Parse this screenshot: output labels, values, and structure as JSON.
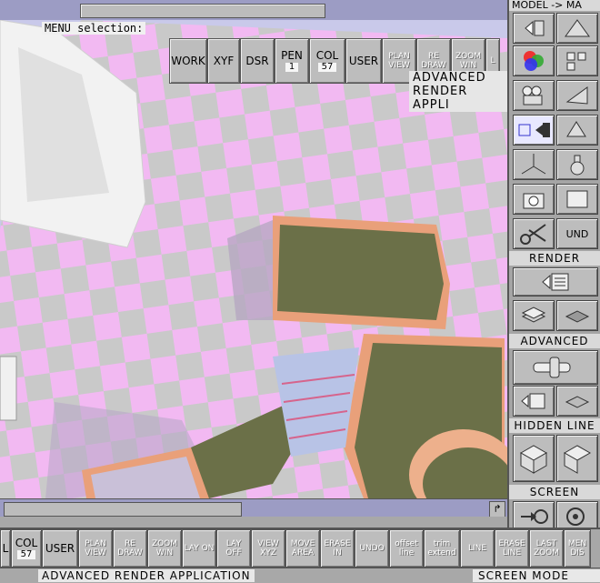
{
  "viewport": {
    "menu_selection": "MENU selection:",
    "title": "ADVANCED RENDER APPLI",
    "toolbar": [
      {
        "name": "work-button",
        "label": "WORK",
        "value": ""
      },
      {
        "name": "xyf-button",
        "label": "XYF",
        "value": ""
      },
      {
        "name": "dsr-button",
        "label": "DSR",
        "value": ""
      },
      {
        "name": "pen-button",
        "label": "PEN",
        "value": "1"
      },
      {
        "name": "col-button",
        "label": "COL",
        "value": "57"
      },
      {
        "name": "user-button",
        "label": "USER",
        "value": ""
      },
      {
        "name": "plan-view-button",
        "label": "PLAN VIEW",
        "value": ""
      },
      {
        "name": "redraw-button",
        "label": "RE DRAW",
        "value": ""
      },
      {
        "name": "zoom-win-button",
        "label": "ZOOM WIN",
        "value": ""
      },
      {
        "name": "more-button",
        "label": "L",
        "value": ""
      }
    ]
  },
  "right_panel": {
    "header": "MODEL -> MA",
    "sections": {
      "render": "RENDER",
      "advanced": "ADVANCED",
      "hidden_line": "HIDDEN LINE",
      "screen": "SCREEN"
    },
    "undo_label": "UND"
  },
  "bottom_toolbar": [
    {
      "label": "L",
      "value": ""
    },
    {
      "label": "COL",
      "value": "57"
    },
    {
      "label": "USER",
      "value": ""
    },
    {
      "label": "PLAN VIEW",
      "value": ""
    },
    {
      "label": "RE DRAW",
      "value": ""
    },
    {
      "label": "ZOOM WIN",
      "value": ""
    },
    {
      "label": "LAY ON",
      "value": ""
    },
    {
      "label": "LAY OFF",
      "value": ""
    },
    {
      "label": "VIEW XYZ",
      "value": ""
    },
    {
      "label": "MOVE AREA",
      "value": ""
    },
    {
      "label": "ERASE IN",
      "value": ""
    },
    {
      "label": "UNDO",
      "value": ""
    },
    {
      "label": "offset line",
      "value": ""
    },
    {
      "label": "trim extend",
      "value": ""
    },
    {
      "label": "LINE",
      "value": ""
    },
    {
      "label": "ERASE LINE",
      "value": ""
    },
    {
      "label": "LAST ZOOM",
      "value": ""
    },
    {
      "label": "MEN DIS",
      "value": ""
    }
  ],
  "status": {
    "left": "ADVANCED RENDER APPLICATION",
    "right": "SCREEN MODE"
  },
  "colors": {
    "accent": "#9c9cc4",
    "panel": "#a5a5a5",
    "floor_pink": "#f0b9f0",
    "floor_grey": "#c8c8c8",
    "roof_olive": "#6b7048",
    "wall_peach": "#e9a07a"
  }
}
